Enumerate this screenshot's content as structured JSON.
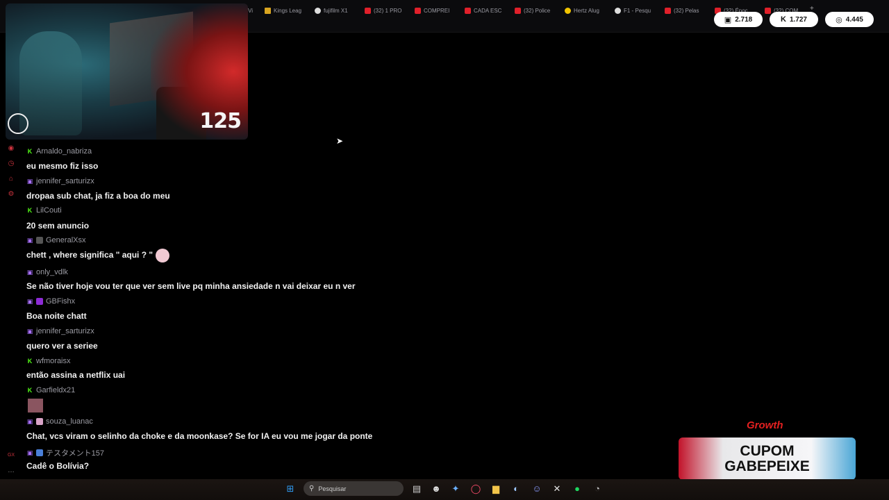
{
  "browser": {
    "tabs": [
      {
        "label": "Kings Leag",
        "icon": "kings-league-icon"
      },
      {
        "label": "fujifilm X1",
        "icon": "google-icon"
      },
      {
        "label": "(32) 1 PRO",
        "icon": "youtube-icon"
      },
      {
        "label": "COMPREI",
        "icon": "youtube-icon"
      },
      {
        "label": "CADA ESC",
        "icon": "youtube-icon"
      },
      {
        "label": "(32) Police",
        "icon": "youtube-icon"
      },
      {
        "label": "Hertz Alug",
        "icon": "hertz-icon"
      },
      {
        "label": "F1 - Pesqu",
        "icon": "google-icon"
      },
      {
        "label": "(32) Pelas",
        "icon": "youtube-icon"
      },
      {
        "label": "(32) Époc",
        "icon": "youtube-icon"
      },
      {
        "label": "(32) COM",
        "icon": "youtube-icon"
      }
    ],
    "partial_tab": "Vi"
  },
  "stats": {
    "twitch_viewers": "2.718",
    "kick_viewers": "1.727",
    "total_viewers": "4.445"
  },
  "webcam": {
    "counter": "125"
  },
  "chat": {
    "messages": [
      {
        "platform": "kick",
        "user": "Arnaldo_nabriza",
        "text": "eu mesmo fiz isso"
      },
      {
        "platform": "twitch",
        "user": "jennifer_sarturizx",
        "text": "dropaa sub chat, ja fiz a boa do meu"
      },
      {
        "platform": "kick",
        "user": "LilCouti",
        "text": "20 sem anuncio"
      },
      {
        "platform": "twitch",
        "user": "GeneralXsx",
        "text": "chett , where significa \" aqui ? \""
      },
      {
        "platform": "twitch",
        "user": "only_vdlk",
        "text": "Se não tiver hoje vou ter que ver sem live pq minha ansiedade n vai deixar eu n ver"
      },
      {
        "platform": "twitch",
        "user": "GBFishx",
        "text": "Boa noite chatt"
      },
      {
        "platform": "twitch",
        "user": "jennifer_sarturizx",
        "text": "quero ver a seriee"
      },
      {
        "platform": "kick",
        "user": "wfmoraisx",
        "text": "então assina a netflix uai"
      },
      {
        "platform": "kick",
        "user": "Garfieldx21",
        "text": ""
      },
      {
        "platform": "twitch",
        "user": "souza_luanac",
        "text": "Chat, vcs viram o selinho da choke e da moonkase? Se for IA eu vou me jogar da ponte"
      },
      {
        "platform": "twitch",
        "user": "テスタメント157",
        "text": "Cadê o Bolívia?"
      }
    ]
  },
  "sponsor": {
    "brand": "Growth",
    "line1": "CUPOM",
    "line2": "GABEPEIXE"
  },
  "taskbar": {
    "search_placeholder": "Pesquisar"
  },
  "colors": {
    "kick": "#53fc18",
    "twitch": "#a970ff",
    "accent_red": "#e32020"
  }
}
